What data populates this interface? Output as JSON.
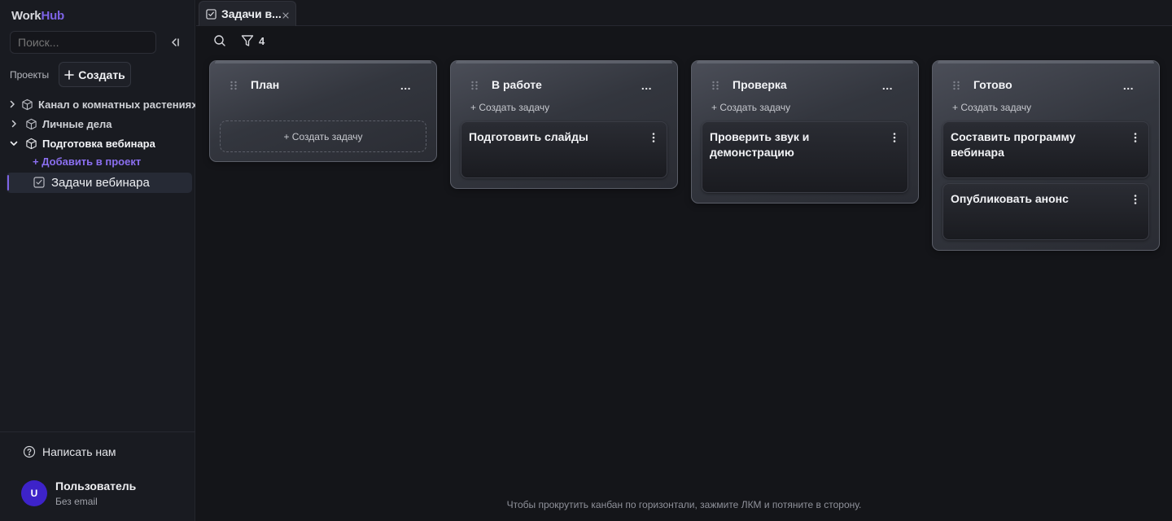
{
  "app": {
    "logo_part1": "Work",
    "logo_part2": "Hub"
  },
  "sidebar": {
    "search_placeholder": "Поиск...",
    "projects_label": "Проекты",
    "create_button": "Создать",
    "projects": [
      {
        "name": "Канал о комнатных растениях",
        "expanded": false
      },
      {
        "name": "Личные дела",
        "expanded": false
      },
      {
        "name": "Подготовка вебинара",
        "expanded": true
      }
    ],
    "add_to_project": "+ Добавить в проект",
    "active_item": "Задачи вебинара",
    "contact_us": "Написать нам",
    "user": {
      "initial": "U",
      "name": "Пользователь",
      "email": "Без email"
    }
  },
  "tabs": [
    {
      "label": "Задачи в..."
    }
  ],
  "toolbar": {
    "filter_count": "4"
  },
  "board": {
    "add_task_label": "+ Создать задачу",
    "more_label": "...",
    "columns": [
      {
        "title": "План",
        "cards": []
      },
      {
        "title": "В работе",
        "cards": [
          "Подготовить слайды"
        ]
      },
      {
        "title": "Проверка",
        "cards": [
          "Проверить звук и демонстрацию"
        ]
      },
      {
        "title": "Готово",
        "cards": [
          "Составить программу вебинара",
          "Опубликовать анонс"
        ]
      }
    ]
  },
  "hint": "Чтобы прокрутить канбан по горизонтали, зажмите ЛКМ и потяните в сторону.",
  "colors": {
    "accent": "#7d63e6",
    "background": "#141519",
    "sidebar": "#191b21",
    "avatar": "#3d23c9"
  }
}
